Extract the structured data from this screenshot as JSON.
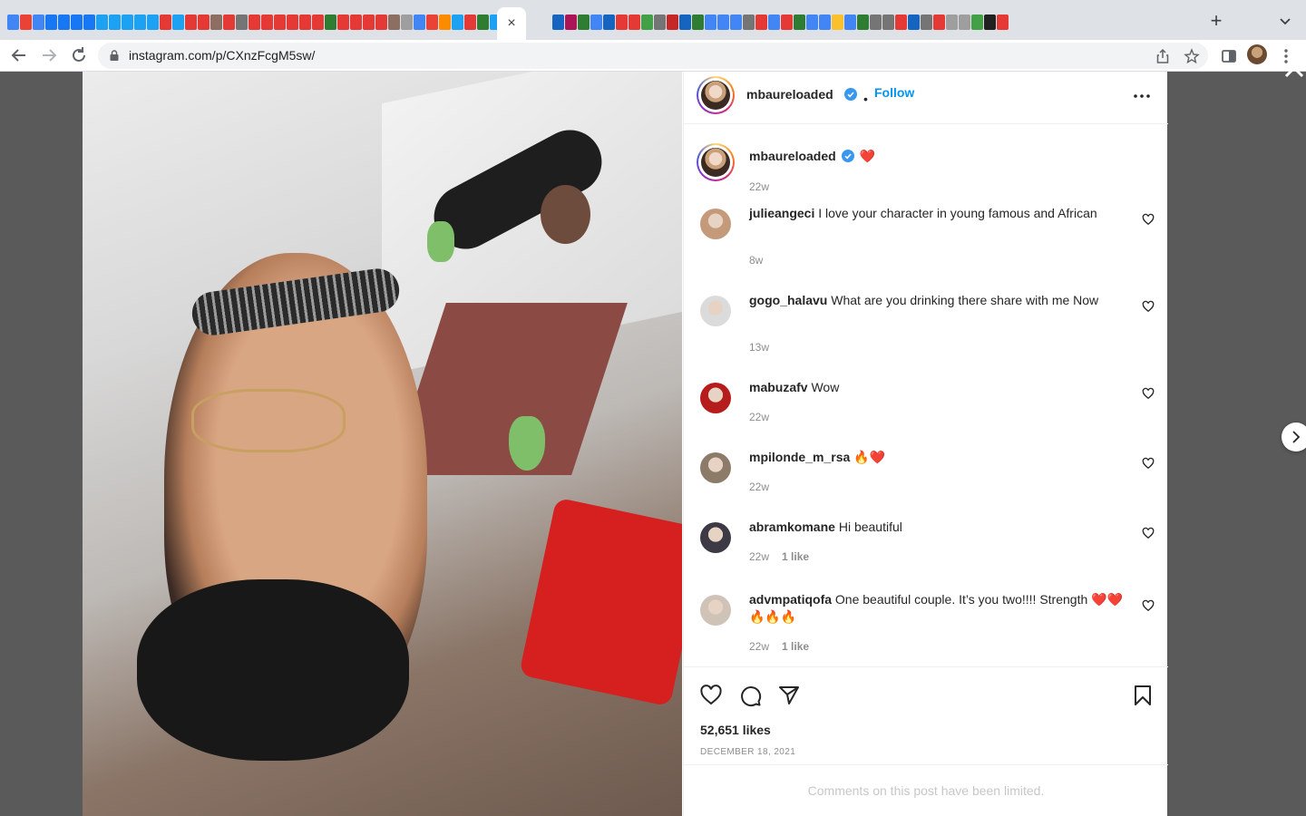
{
  "browser": {
    "url": "instagram.com/p/CXnzFcgM5sw/",
    "active_tab_close": "×",
    "new_tab": "+",
    "tab_favicon_colors": [
      "#4285f4",
      "#ea4335",
      "#4285f4",
      "#1877f2",
      "#1877f2",
      "#1877f2",
      "#1877f2",
      "#1da1f2",
      "#1da1f2",
      "#1da1f2",
      "#1da1f2",
      "#1da1f2",
      "#e53935",
      "#1da1f2",
      "#e53935",
      "#e53935",
      "#8d6e63",
      "#e53935",
      "#757575",
      "#e53935",
      "#e53935",
      "#e53935",
      "#e53935",
      "#e53935",
      "#e53935",
      "#2e7d32",
      "#e53935",
      "#e53935",
      "#e53935",
      "#e53935",
      "#8d6e63",
      "#9e9e9e",
      "#4285f4",
      "#ea4335",
      "#fb8c00",
      "#1da1f2",
      "#e53935",
      "#2e7d32",
      "#1da1f2",
      "#2e7d32",
      "#1565c0",
      "#ad1457",
      "#2e7d32",
      "#4285f4",
      "#1565c0",
      "#e53935",
      "#e53935",
      "#43a047",
      "#757575",
      "#c62828",
      "#1565c0",
      "#2e7d32",
      "#4285f4",
      "#4285f4",
      "#4285f4",
      "#757575",
      "#e53935",
      "#4285f4",
      "#e53935",
      "#2e7d32",
      "#4285f4",
      "#4285f4",
      "#fbc02d",
      "#4285f4",
      "#2e7d32",
      "#757575",
      "#757575",
      "#e53935",
      "#1565c0",
      "#757575",
      "#e53935",
      "#9e9e9e",
      "#9e9e9e",
      "#43a047",
      "#212121",
      "#e53935"
    ]
  },
  "post": {
    "header": {
      "username": "mbaureloaded",
      "follow_label": "Follow",
      "dot": "•"
    },
    "caption": {
      "username": "mbaureloaded",
      "text": "❤️",
      "age": "22w"
    },
    "comments": [
      {
        "username": "julieangeci",
        "text": "I love your character in young famous and African",
        "age": "8w",
        "likes": "",
        "avatar": "#c49a7a"
      },
      {
        "username": "gogo_halavu",
        "text": "What are you drinking there share with me Now",
        "age": "13w",
        "likes": "",
        "avatar": "#dbdbdb"
      },
      {
        "username": "mabuzafv",
        "text": "Wow",
        "age": "22w",
        "likes": "",
        "avatar": "#b71c1c"
      },
      {
        "username": "mpilonde_m_rsa",
        "text": "🔥❤️",
        "age": "22w",
        "likes": "",
        "avatar": "#8d7b6a"
      },
      {
        "username": "abramkomane",
        "text": "Hi beautiful",
        "age": "22w",
        "likes": "1 like",
        "avatar": "#3e3a45"
      },
      {
        "username": "advmpatiqofa",
        "text": "One beautiful couple. It’s you two!!!! Strength ❤️❤️🔥🔥🔥",
        "age": "22w",
        "likes": "1 like",
        "avatar": "#cfc3b8"
      }
    ],
    "likes_count": "52,651 likes",
    "date": "DECEMBER 18, 2021",
    "limited_notice": "Comments on this post have been limited."
  }
}
